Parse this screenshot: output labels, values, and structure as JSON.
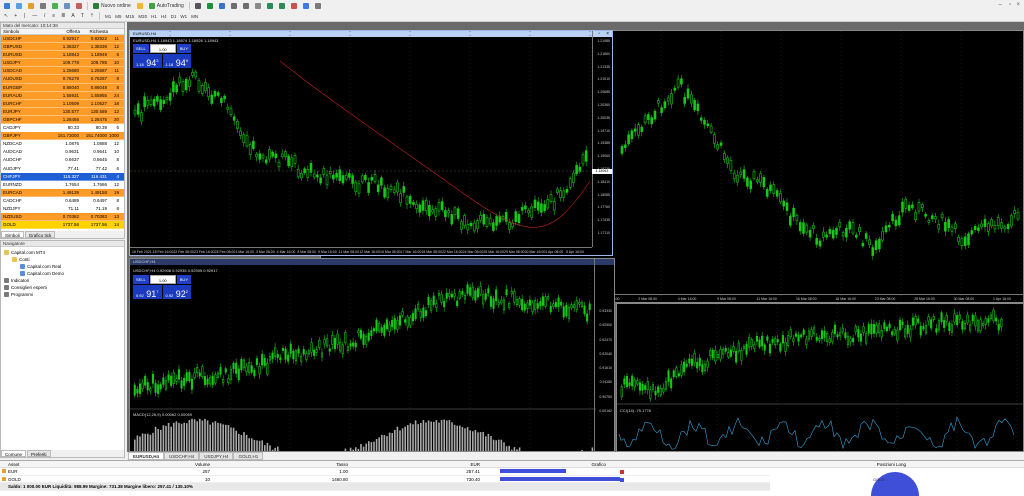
{
  "toolbar": {
    "new_order": "Nuovo ordine",
    "autotrading": "AutoTrading",
    "timeframes": [
      "M1",
      "M5",
      "M15",
      "M30",
      "H1",
      "H4",
      "D1",
      "W1",
      "MN"
    ]
  },
  "market_watch": {
    "title": "Mato del mercato: 10:14:38",
    "columns": [
      "Simbolo",
      "Offerta",
      "Richiesta"
    ],
    "rows": [
      {
        "symbol": "USDCHF",
        "bid": "0.92917",
        "ask": "0.92922",
        "spread": "11",
        "color": "#ff9c28"
      },
      {
        "symbol": "GBPUSD",
        "bid": "1.38327",
        "ask": "1.38339",
        "spread": "12",
        "color": "#ff9c28"
      },
      {
        "symbol": "EURUSD",
        "bid": "1.18943",
        "ask": "1.18949",
        "spread": "6",
        "color": "#ff9c28"
      },
      {
        "symbol": "USDJPY",
        "bid": "109.778",
        "ask": "109.785",
        "spread": "10",
        "color": "#ff9c28"
      },
      {
        "symbol": "USDCAD",
        "bid": "1.25680",
        "ask": "1.25687",
        "spread": "11",
        "color": "#ff9c28"
      },
      {
        "symbol": "AUDUSD",
        "bid": "0.76279",
        "ask": "0.76287",
        "spread": "8",
        "color": "#ff9c28"
      },
      {
        "symbol": "EURGBP",
        "bid": "0.86040",
        "ask": "0.86048",
        "spread": "8",
        "color": "#ff9c28"
      },
      {
        "symbol": "EURAUD",
        "bid": "1.55931",
        "ask": "1.55955",
        "spread": "24",
        "color": "#ff9c28"
      },
      {
        "symbol": "EURCHF",
        "bid": "1.10509",
        "ask": "1.10527",
        "spread": "18",
        "color": "#ff9c28"
      },
      {
        "symbol": "EURJPY",
        "bid": "130.577",
        "ask": "130.589",
        "spread": "12",
        "color": "#ff9c28"
      },
      {
        "symbol": "GBPCHF",
        "bid": "1.28455",
        "ask": "1.28475",
        "spread": "20",
        "color": "#ff9c28"
      },
      {
        "symbol": "CADJPY",
        "bid": "80.33",
        "ask": "80.39",
        "spread": "6",
        "color": "#ffffff"
      },
      {
        "symbol": "GBPJPY",
        "bid": "151.73000",
        "ask": "151.74000",
        "spread": "1000",
        "color": "#ff9c28"
      },
      {
        "symbol": "NZDCAD",
        "bid": "1.0876",
        "ask": "1.0888",
        "spread": "12",
        "color": "#ffffff"
      },
      {
        "symbol": "AUDCAD",
        "bid": "0.9631",
        "ask": "0.9641",
        "spread": "10",
        "color": "#ffffff"
      },
      {
        "symbol": "AUDCHF",
        "bid": "0.6637",
        "ask": "0.6645",
        "spread": "8",
        "color": "#ffffff"
      },
      {
        "symbol": "AUDJPY",
        "bid": "77.41",
        "ask": "77.42",
        "spread": "6",
        "color": "#ffffff"
      },
      {
        "symbol": "CHFJPY",
        "bid": "116.327",
        "ask": "116.431",
        "spread": "4",
        "color": "#1f5fd6"
      },
      {
        "symbol": "EURNZD",
        "bid": "1.7654",
        "ask": "1.7666",
        "spread": "12",
        "color": "#ffffff"
      },
      {
        "symbol": "EURCAD",
        "bid": "1.49139",
        "ask": "1.49158",
        "spread": "19",
        "color": "#ff9c28"
      },
      {
        "symbol": "CADCHF",
        "bid": "0.6489",
        "ask": "0.6497",
        "spread": "8",
        "color": "#ffffff"
      },
      {
        "symbol": "NZDJPY",
        "bid": "71.11",
        "ask": "71.19",
        "spread": "8",
        "color": "#ffffff"
      },
      {
        "symbol": "NZDUSD",
        "bid": "0.70362",
        "ask": "0.70383",
        "spread": "13",
        "color": "#ff9c28"
      },
      {
        "symbol": "GOLD",
        "bid": "1737.56",
        "ask": "1737.56",
        "spread": "14",
        "color": "#ffd200"
      }
    ],
    "tabs": [
      "Simboli",
      "Grafico tick"
    ]
  },
  "navigator": {
    "title": "Navigatore",
    "items": [
      {
        "label": "Capital.com MT4",
        "indent": 0,
        "icon": "folder-icon"
      },
      {
        "label": "Conti",
        "indent": 1,
        "icon": "folder-icon"
      },
      {
        "label": "Capital.com Real",
        "indent": 2,
        "icon": "account-icon"
      },
      {
        "label": "Capital.com Demo",
        "indent": 2,
        "icon": "account-icon"
      },
      {
        "label": "Indicatori",
        "indent": 0,
        "icon": "indicator-icon"
      },
      {
        "label": "Consiglieri esperti",
        "indent": 0,
        "icon": "expert-icon"
      },
      {
        "label": "Programmi",
        "indent": 0,
        "icon": "script-icon"
      }
    ],
    "tabs": [
      "Comune",
      "Preferiti"
    ]
  },
  "trade_widgets": {
    "sell": "SELL",
    "buy": "BUY",
    "lot": "1.00",
    "big": {
      "sell_prefix": "1.18",
      "sell_main": "94",
      "sell_sup": "3",
      "buy_prefix": "1.18",
      "buy_main": "94",
      "buy_sup": "9"
    },
    "small": {
      "sell_prefix": "0.92",
      "sell_main": "91",
      "sell_sup": "7",
      "buy_prefix": "0.92",
      "buy_main": "92",
      "buy_sup": "2"
    }
  },
  "charts": {
    "eurusd": {
      "title": "EURUSD,H4",
      "info": "EURUSD,H4  1.18943 1.18974 1.18926 1.18943",
      "y_ticks": [
        "1.21985",
        "1.21660",
        "1.21335",
        "1.21010",
        "1.20685",
        "1.20360",
        "1.20035",
        "1.19710",
        "1.19385",
        "1.19060",
        "1.18735",
        "1.18410",
        "1.18085",
        "1.17760",
        "1.17435",
        "1.17110"
      ],
      "x_ticks": [
        "16 Feb 2021",
        "18 Feb 16:00",
        "22 Feb 08:00",
        "23 Feb 16:00",
        "25 Feb 08:00",
        "1 Mar 16:00",
        "3 Mar 08:00",
        "4 Mar 16:00",
        "8 Mar 08:00",
        "9 Mar 16:00",
        "11 Mar 08:00",
        "12 Mar 16:00",
        "16 Mar 08:00",
        "17 Mar 16:00",
        "19 Mar 08:00",
        "22 Mar 16:00",
        "24 Mar 08:00",
        "25 Mar 16:00",
        "29 Mar 08:00",
        "30 Mar 16:00",
        "1 Apr 08:00",
        "5 Apr 16:00"
      ],
      "price_label": "1.18943"
    },
    "usdchf": {
      "title": "USDCHF,H4",
      "info": "USDCHF,H4  0.92908 0.92935 0.92905 0.92917",
      "macd_label": "MACD(12,26,9) 0.00062 0.00069",
      "price_label": "0.92917",
      "y_ticks": [
        "0.93330",
        "0.92900",
        "0.92470",
        "0.92040",
        "0.91610",
        "0.91180",
        "0.90750",
        "0.00162"
      ]
    },
    "back": {
      "x_ticks": [
        "1 Feb 2021",
        "4 Feb 16:00",
        "9 Feb 08:00",
        "11 Feb 16:00",
        "16 Feb 08:00",
        "18 Feb 16:00",
        "23 Feb 08:00",
        "25 Feb 16:00",
        "2 Mar 08:00",
        "4 Mar 16:00",
        "9 Mar 08:00",
        "11 Mar 16:00",
        "16 Mar 08:00",
        "18 Mar 16:00",
        "23 Mar 08:00",
        "25 Mar 16:00",
        "30 Mar 08:00",
        "1 Apr 16:00"
      ]
    },
    "third": {
      "cci_label": "CCI(14) -79.1778",
      "x_ticks": [
        "22 Mar 2021",
        "23 Mar 16:00",
        "25 Mar 08:00",
        "26 Mar 16:00",
        "30 Mar 08:00",
        "31 Mar 16:00",
        "2 Apr 08:00",
        "5 Apr 16:00",
        "7 Apr 00:00"
      ]
    }
  },
  "chart_tabs": [
    "EURUSD,H4",
    "USDCHF,H4",
    "USDJPY,H4",
    "GOLD,H1"
  ],
  "terminal": {
    "columns": [
      "Asset",
      "Volume",
      "Tasso",
      "EUR",
      "Grafico"
    ],
    "rows": [
      {
        "asset": "EUR",
        "volume": "257",
        "rate": "1.00",
        "eur": "257.41",
        "bar": 0.55
      },
      {
        "asset": "GOLD",
        "volume": "10",
        "rate": "1460.80",
        "eur": "730.40",
        "bar": 1.0
      }
    ],
    "balance_line": "Saldo: 1 000.00 EUR  Liquidità: 988.99  Margine: 731.38  Margine libero: 257.41 / 135.10%",
    "positions_title": "Posizioni Long",
    "pie_label": "GOLD"
  }
}
